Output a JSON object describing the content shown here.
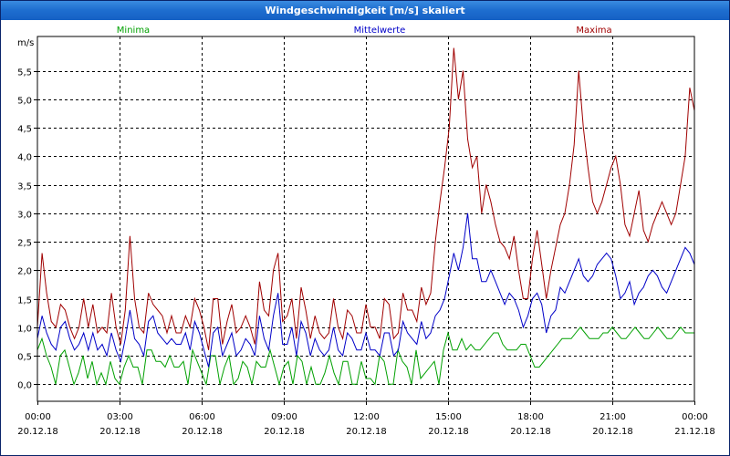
{
  "window": {
    "title": "Windgeschwindigkeit [m/s] skaliert"
  },
  "chart_data": {
    "type": "line",
    "title": "Windgeschwindigkeit [m/s] skaliert",
    "ylabel": "m/s",
    "xlabel": "",
    "ylim": [
      -0.3,
      6.1
    ],
    "xlim_hours": [
      0,
      24
    ],
    "grid": true,
    "legend_placement": "top",
    "y_ticks": [
      "0,0",
      "0,5",
      "1,0",
      "1,5",
      "2,0",
      "2,5",
      "3,0",
      "3,5",
      "4,0",
      "4,5",
      "5,0",
      "5,5"
    ],
    "x_ticks": [
      {
        "time": "00:00",
        "date": "20.12.18"
      },
      {
        "time": "03:00",
        "date": "20.12.18"
      },
      {
        "time": "06:00",
        "date": "20.12.18"
      },
      {
        "time": "09:00",
        "date": "20.12.18"
      },
      {
        "time": "12:00",
        "date": "20.12.18"
      },
      {
        "time": "15:00",
        "date": "20.12.18"
      },
      {
        "time": "18:00",
        "date": "20.12.18"
      },
      {
        "time": "21:00",
        "date": "20.12.18"
      },
      {
        "time": "00:00",
        "date": "21.12.18"
      }
    ],
    "series": [
      {
        "name": "Minima",
        "color": "#00a000",
        "values": [
          0.6,
          0.8,
          0.5,
          0.3,
          0.0,
          0.5,
          0.6,
          0.3,
          0.0,
          0.2,
          0.5,
          0.1,
          0.4,
          0.0,
          0.2,
          0.0,
          0.4,
          0.1,
          0.0,
          0.3,
          0.5,
          0.3,
          0.3,
          0.0,
          0.6,
          0.6,
          0.4,
          0.4,
          0.3,
          0.5,
          0.3,
          0.3,
          0.4,
          0.0,
          0.6,
          0.4,
          0.2,
          0.0,
          0.5,
          0.5,
          0.0,
          0.3,
          0.5,
          0.0,
          0.1,
          0.4,
          0.3,
          0.0,
          0.4,
          0.3,
          0.3,
          0.6,
          0.3,
          0.0,
          0.3,
          0.4,
          0.0,
          0.5,
          0.4,
          0.0,
          0.3,
          0.0,
          0.0,
          0.2,
          0.5,
          0.2,
          0.0,
          0.4,
          0.4,
          0.0,
          0.0,
          0.4,
          0.1,
          0.1,
          0.0,
          0.5,
          0.4,
          0.0,
          0.0,
          0.6,
          0.4,
          0.3,
          0.0,
          0.6,
          0.1,
          0.2,
          0.3,
          0.4,
          0.0,
          0.6,
          0.9,
          0.6,
          0.6,
          0.8,
          0.6,
          0.7,
          0.6,
          0.6,
          0.7,
          0.8,
          0.9,
          0.9,
          0.7,
          0.6,
          0.6,
          0.6,
          0.7,
          0.7,
          0.5,
          0.3,
          0.3,
          0.4,
          0.5,
          0.6,
          0.7,
          0.8,
          0.8,
          0.8,
          0.9,
          1.0,
          0.9,
          0.8,
          0.8,
          0.8,
          0.9,
          0.9,
          1.0,
          0.9,
          0.8,
          0.8,
          0.9,
          1.0,
          0.9,
          0.8,
          0.8,
          0.9,
          1.0,
          0.9,
          0.8,
          0.8,
          0.9,
          1.0,
          0.9,
          0.9,
          0.9
        ]
      },
      {
        "name": "Mittelwerte",
        "color": "#0000c8",
        "values": [
          0.8,
          1.2,
          0.9,
          0.7,
          0.6,
          1.0,
          1.1,
          0.8,
          0.6,
          0.7,
          0.9,
          0.6,
          0.9,
          0.6,
          0.7,
          0.5,
          0.9,
          0.6,
          0.4,
          0.8,
          1.3,
          0.8,
          0.7,
          0.5,
          1.1,
          1.2,
          0.9,
          0.8,
          0.7,
          0.8,
          0.7,
          0.7,
          0.9,
          0.6,
          1.1,
          0.9,
          0.6,
          0.3,
          0.9,
          1.0,
          0.5,
          0.7,
          0.9,
          0.5,
          0.6,
          0.8,
          0.7,
          0.5,
          1.2,
          0.8,
          0.6,
          1.2,
          1.6,
          0.7,
          0.7,
          1.0,
          0.5,
          1.1,
          0.9,
          0.5,
          0.8,
          0.6,
          0.5,
          0.6,
          1.0,
          0.6,
          0.5,
          0.9,
          0.8,
          0.6,
          0.6,
          0.9,
          0.6,
          0.6,
          0.5,
          0.9,
          0.9,
          0.5,
          0.6,
          1.1,
          0.9,
          0.8,
          0.7,
          1.1,
          0.8,
          0.9,
          1.2,
          1.3,
          1.5,
          1.9,
          2.3,
          2.0,
          2.4,
          3.0,
          2.2,
          2.2,
          1.8,
          1.8,
          2.0,
          1.8,
          1.6,
          1.4,
          1.6,
          1.5,
          1.3,
          1.0,
          1.2,
          1.5,
          1.6,
          1.4,
          0.9,
          1.2,
          1.3,
          1.7,
          1.6,
          1.8,
          2.0,
          2.2,
          1.9,
          1.8,
          1.9,
          2.1,
          2.2,
          2.3,
          2.2,
          1.9,
          1.5,
          1.6,
          1.8,
          1.4,
          1.6,
          1.7,
          1.9,
          2.0,
          1.9,
          1.7,
          1.6,
          1.8,
          2.0,
          2.2,
          2.4,
          2.3,
          2.1
        ]
      },
      {
        "name": "Maxima",
        "color": "#a00000",
        "values": [
          1.0,
          2.3,
          1.6,
          1.1,
          1.0,
          1.4,
          1.3,
          1.0,
          0.8,
          1.0,
          1.5,
          1.0,
          1.4,
          0.9,
          1.0,
          0.9,
          1.6,
          1.0,
          0.7,
          1.3,
          2.6,
          1.5,
          1.0,
          0.9,
          1.6,
          1.4,
          1.3,
          1.2,
          0.9,
          1.2,
          0.9,
          0.9,
          1.2,
          1.0,
          1.5,
          1.3,
          1.0,
          0.6,
          1.5,
          1.5,
          0.7,
          1.1,
          1.4,
          0.9,
          1.0,
          1.2,
          1.0,
          0.7,
          1.8,
          1.3,
          1.2,
          2.0,
          2.3,
          1.1,
          1.2,
          1.5,
          0.8,
          1.7,
          1.3,
          0.8,
          1.2,
          0.9,
          0.8,
          0.9,
          1.5,
          1.0,
          0.8,
          1.3,
          1.2,
          0.9,
          0.9,
          1.4,
          1.0,
          1.0,
          0.8,
          1.5,
          1.4,
          0.8,
          0.9,
          1.6,
          1.3,
          1.3,
          1.1,
          1.7,
          1.4,
          1.6,
          2.5,
          3.2,
          3.8,
          4.5,
          5.9,
          5.0,
          5.5,
          4.3,
          3.8,
          4.0,
          3.0,
          3.5,
          3.2,
          2.8,
          2.5,
          2.4,
          2.2,
          2.6,
          2.0,
          1.5,
          1.5,
          2.2,
          2.7,
          2.1,
          1.5,
          2.0,
          2.4,
          2.8,
          3.0,
          3.5,
          4.2,
          5.5,
          4.5,
          3.8,
          3.2,
          3.0,
          3.2,
          3.5,
          3.8,
          4.0,
          3.5,
          2.8,
          2.6,
          3.0,
          3.4,
          2.7,
          2.5,
          2.8,
          3.0,
          3.2,
          3.0,
          2.8,
          3.0,
          3.5,
          4.0,
          5.2,
          4.8
        ]
      }
    ]
  }
}
